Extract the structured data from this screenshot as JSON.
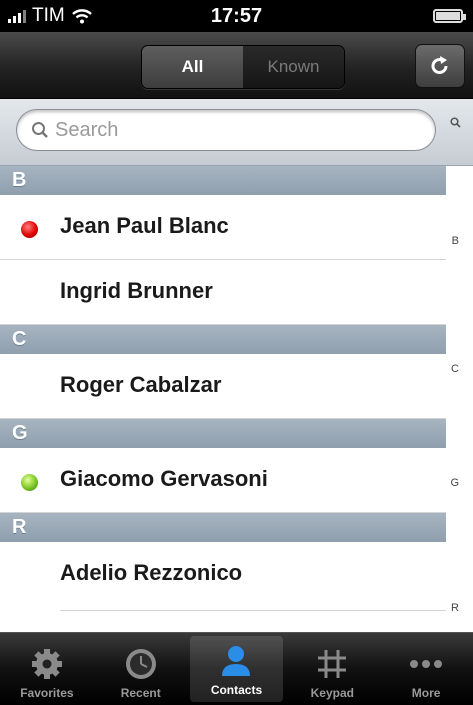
{
  "status_bar": {
    "carrier": "TIM",
    "time": "17:57"
  },
  "nav": {
    "segments": [
      {
        "label": "All",
        "selected": true
      },
      {
        "label": "Known",
        "selected": false
      }
    ],
    "refresh_icon": "refresh-icon"
  },
  "search": {
    "placeholder": "Search"
  },
  "sections": [
    {
      "letter": "B",
      "contacts": [
        {
          "name": "Jean Paul Blanc",
          "status": "red"
        },
        {
          "name": "Ingrid Brunner",
          "status": "none"
        }
      ]
    },
    {
      "letter": "C",
      "contacts": [
        {
          "name": "Roger Cabalzar",
          "status": "none"
        }
      ]
    },
    {
      "letter": "G",
      "contacts": [
        {
          "name": "Giacomo Gervasoni",
          "status": "green"
        }
      ]
    },
    {
      "letter": "R",
      "contacts": [
        {
          "name": "Adelio Rezzonico",
          "status": "none"
        }
      ]
    }
  ],
  "index_letters": [
    "B",
    "C",
    "G",
    "R"
  ],
  "tabs": [
    {
      "label": "Favorites",
      "icon": "gear-icon",
      "active": false
    },
    {
      "label": "Recent",
      "icon": "clock-icon",
      "active": false
    },
    {
      "label": "Contacts",
      "icon": "person-icon",
      "active": true
    },
    {
      "label": "Keypad",
      "icon": "hash-icon",
      "active": false
    },
    {
      "label": "More",
      "icon": "ellipsis-icon",
      "active": false
    }
  ],
  "colors": {
    "status_red": "#e00000",
    "status_green": "#7ac623",
    "active_tab_icon": "#2a8de8"
  }
}
